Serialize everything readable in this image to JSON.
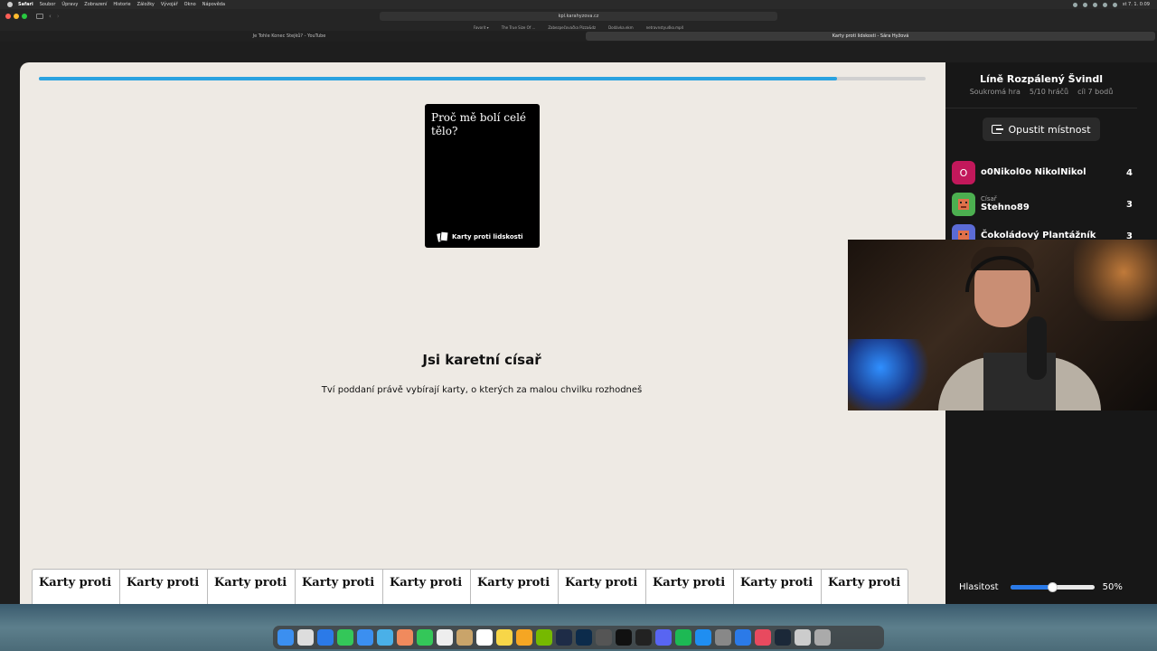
{
  "menubar": {
    "items": [
      "Safari",
      "Soubor",
      "Úpravy",
      "Zobrazení",
      "Historie",
      "Záložky",
      "Vývojář",
      "Okno",
      "Nápověda"
    ],
    "clock": "st 7. 1. 0:09"
  },
  "browser": {
    "url": "kpl.karahyzova.cz",
    "favorites": [
      "Favorit ▾",
      "The True Size Of ...",
      "Zabezpečovačka Pizza&dz",
      "Dodávka.ekm",
      "netravnstyu4ko.mp4"
    ],
    "tabs": [
      {
        "label": "Je Tohle Konec Stejků? - YouTube"
      },
      {
        "label": "Karty proti lidskosti - Sára Hyžová"
      }
    ]
  },
  "game": {
    "progress_fraction": 0.9,
    "black_card": {
      "text": "Proč mě bolí celé tělo?",
      "brand": "Karty proti lidskosti"
    },
    "czar_title": "Jsi karetní císař",
    "czar_subtitle": "Tví poddaní právě vybírají karty, o kterých za malou chvilku rozhodneš",
    "hand": [
      {
        "text": "Karty proti"
      },
      {
        "text": "Karty proti"
      },
      {
        "text": "Karty proti"
      },
      {
        "text": "Karty proti"
      },
      {
        "text": "Karty proti"
      },
      {
        "text": "Karty proti"
      },
      {
        "text": "Karty proti"
      },
      {
        "text": "Karty proti"
      },
      {
        "text": "Karty proti"
      },
      {
        "text": "Karty proti"
      }
    ]
  },
  "sidebar": {
    "room_name": "Líně Rozpálený Švindl",
    "room_type": "Soukromá hra",
    "players_count": "5/10 hráčů",
    "goal": "cíl 7 bodů",
    "leave_label": "Opustit místnost",
    "players": [
      {
        "initial": "O",
        "role": "",
        "name": "o0Nikol0o NikolNikol",
        "score": "4",
        "color": "#c2185b"
      },
      {
        "initial": "",
        "role": "Císař",
        "name": "Stehno89",
        "score": "3",
        "color": "#4caf50"
      },
      {
        "initial": "",
        "role": "",
        "name": "Čokoládový Plantážník",
        "score": "3",
        "color": "#5b6bd6"
      }
    ],
    "volume_label": "Hlasitost",
    "volume_value": "50%",
    "volume_fraction": 0.5
  },
  "colors": {
    "accent": "#2aa3e0",
    "game_bg": "#eeeae4",
    "sidebar_bg": "#171717"
  }
}
